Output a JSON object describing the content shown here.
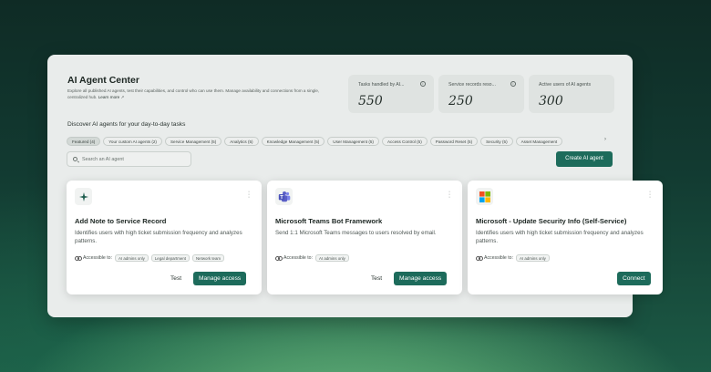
{
  "header": {
    "title": "AI Agent Center",
    "description": "Explore all published AI agents, test their capabilities, and control who can use them. Manage availability and connections from a single, centralized hub.",
    "learn_more": "Learn more"
  },
  "stats": [
    {
      "label": "Tasks handled by AI...",
      "value": "550"
    },
    {
      "label": "Service records reso...",
      "value": "250"
    },
    {
      "label": "Active users of AI agents",
      "value": "300"
    }
  ],
  "discover_label": "Discover AI agents for your day-to-day tasks",
  "tabs": [
    "Featured (4)",
    "Your custom AI agents (2)",
    "Service Management (5)",
    "Analytics (5)",
    "Knowledge Management (5)",
    "User Management (5)",
    "Access Control (5)",
    "Password Reset (5)",
    "Security (5)",
    "Asset Management"
  ],
  "search": {
    "placeholder": "Search an AI agent"
  },
  "create_button": "Create AI agent",
  "accessible_label": "Accessible to:",
  "cards": [
    {
      "title": "Add Note to Service Record",
      "description": "Identifies users with high ticket submission frequency and analyzes patterns.",
      "chips": [
        "AI admins only",
        "Legal department",
        "Network team"
      ],
      "test": "Test",
      "action": "Manage access"
    },
    {
      "title": "Microsoft Teams Bot Framework",
      "description": "Send 1:1 Microsoft Teams messages to users resolved by email.",
      "chips": [
        "AI admins only"
      ],
      "test": "Test",
      "action": "Manage access"
    },
    {
      "title": "Microsoft - Update Security Info (Self-Service)",
      "description": "Identifies users with high ticket submission frequency and analyzes patterns.",
      "chips": [
        "AI admins only"
      ],
      "action": "Connect"
    }
  ],
  "colors": {
    "accent": "#1d6b5b",
    "teams": "#5b5fc7"
  }
}
